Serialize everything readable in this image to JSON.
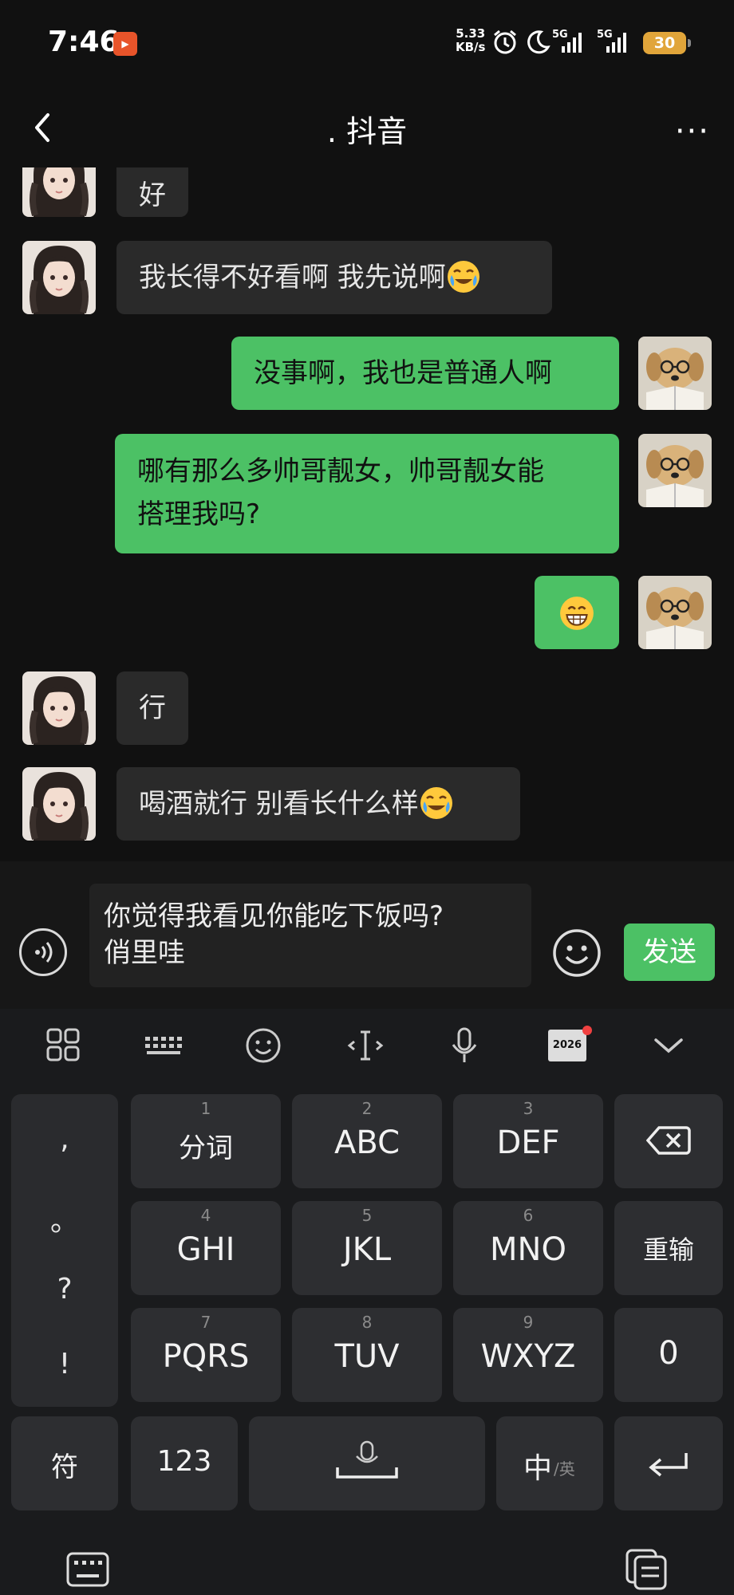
{
  "status": {
    "time": "7:46",
    "net_speed": "5.33",
    "net_unit": "KB/s",
    "sim1": "5G",
    "sim2": "5G",
    "battery": "30"
  },
  "header": {
    "title": ". 抖音",
    "more": "···"
  },
  "messages": [
    {
      "side": "left",
      "text": "好"
    },
    {
      "side": "left",
      "text": "我长得不好看啊 我先说啊",
      "emoji": "crying-laugh"
    },
    {
      "side": "right",
      "text": "没事啊，我也是普通人啊"
    },
    {
      "side": "right",
      "line1": "哪有那么多帅哥靓女，帅哥靓女能",
      "line2": "搭理我吗?"
    },
    {
      "side": "right",
      "emoji": "grin"
    },
    {
      "side": "left",
      "text": "行"
    },
    {
      "side": "left",
      "text": "喝酒就行 别看长什么样",
      "emoji": "crying-laugh"
    }
  ],
  "input": {
    "line1": "你觉得我看见你能吃下饭吗?",
    "line2": "俏里哇",
    "send_label": "发送"
  },
  "toolbar": {
    "icons": [
      "apps-icon",
      "keyboard-icon",
      "emoji-icon",
      "cursor-icon",
      "mic-icon",
      "calendar-2026-icon",
      "collapse-icon"
    ],
    "calendar_text": "2026"
  },
  "keyboard": {
    "side": [
      ",",
      "。",
      "?",
      "!"
    ],
    "row1": [
      {
        "num": "1",
        "label": "分词"
      },
      {
        "num": "2",
        "label": "ABC"
      },
      {
        "num": "3",
        "label": "DEF"
      }
    ],
    "row2": [
      {
        "num": "4",
        "label": "GHI"
      },
      {
        "num": "5",
        "label": "JKL"
      },
      {
        "num": "6",
        "label": "MNO"
      }
    ],
    "row3": [
      {
        "num": "7",
        "label": "PQRS"
      },
      {
        "num": "8",
        "label": "TUV"
      },
      {
        "num": "9",
        "label": "WXYZ"
      }
    ],
    "reenter": "重输",
    "zero": "0",
    "symbols": "符",
    "numbers": "123",
    "lang_main": "中",
    "lang_sub": "/英"
  },
  "colors": {
    "bubble_right": "#4cc165",
    "bubble_left": "#2a2a2a",
    "send": "#4cc165",
    "battery": "#e1a53a"
  }
}
